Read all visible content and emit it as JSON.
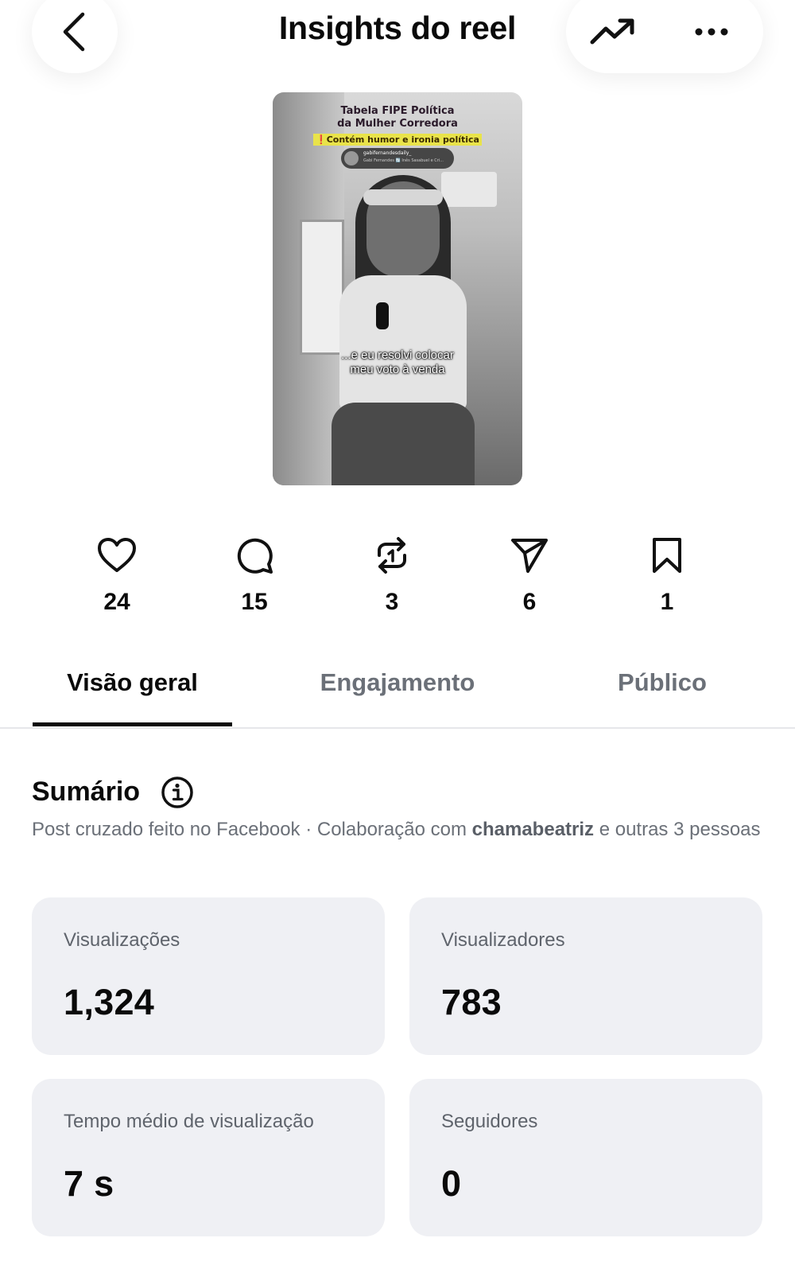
{
  "header": {
    "title": "Insights do reel",
    "back_icon": "chevron-left-icon",
    "trend_icon": "trending-up-icon",
    "more_icon": "more-horizontal-icon"
  },
  "thumbnail": {
    "headline_line1": "Tabela FIPE Política",
    "headline_line2": "da Mulher Corredora",
    "warning": "❗Contém humor e ironia política",
    "overlay_user": "gabifernandesdaily_",
    "overlay_sub": "Gabi Fernandes 🔄 Inês Sasabuel e Cri...",
    "caption_line1": "...e eu resolvi colocar",
    "caption_line2": "meu voto à venda"
  },
  "stats": [
    {
      "icon": "heart-icon",
      "value": "24"
    },
    {
      "icon": "comment-icon",
      "value": "15"
    },
    {
      "icon": "repost-icon",
      "value": "3"
    },
    {
      "icon": "send-icon",
      "value": "6"
    },
    {
      "icon": "bookmark-icon",
      "value": "1"
    }
  ],
  "tabs": [
    {
      "label": "Visão geral",
      "active": true
    },
    {
      "label": "Engajamento",
      "active": false
    },
    {
      "label": "Público",
      "active": false
    }
  ],
  "summary": {
    "title": "Sumário",
    "desc_prefix": "Post cruzado feito no Facebook · Colaboração com ",
    "desc_user": "chamabeatriz",
    "desc_suffix": " e outras 3 pessoas"
  },
  "metrics": [
    {
      "label": "Visualizações",
      "value": "1,324"
    },
    {
      "label": "Visualizadores",
      "value": "783"
    },
    {
      "label": "Tempo médio de visualização",
      "value": "7 s"
    },
    {
      "label": "Seguidores",
      "value": "0"
    }
  ],
  "colors": {
    "text_primary": "#0a0a0a",
    "text_secondary": "#6b7078",
    "card_bg": "#eff0f4",
    "divider": "#e6e7ea"
  }
}
